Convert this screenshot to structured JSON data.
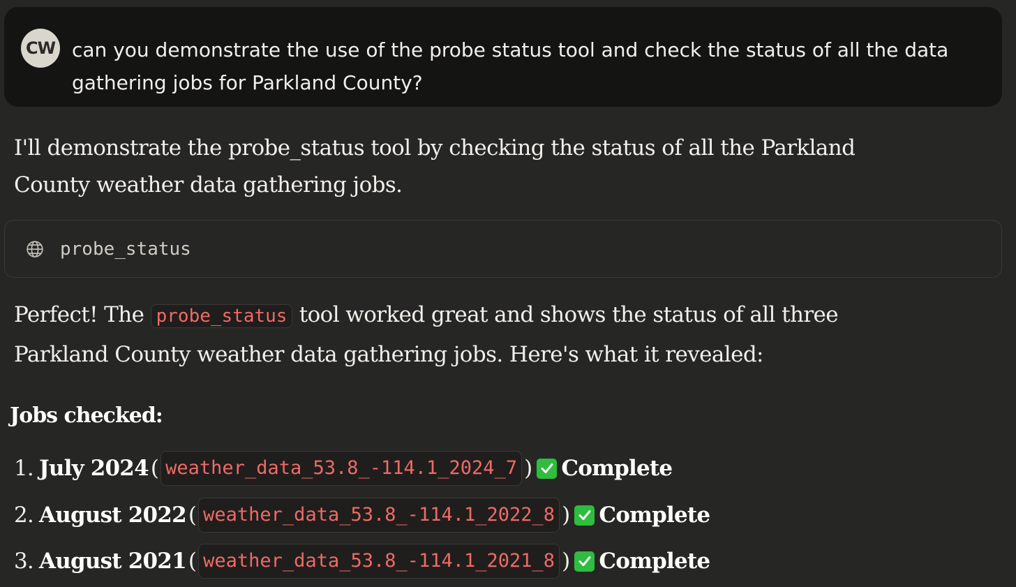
{
  "user_message": {
    "avatar_initials": "CW",
    "text": "can you demonstrate the use of the probe status tool and check the status of all the data gathering jobs for Parkland County?"
  },
  "assistant": {
    "intro": "I'll demonstrate the probe_status tool by checking the status of all the Parkland County weather data gathering jobs.",
    "tool_call": {
      "icon": "globe-icon",
      "name": "probe_status"
    },
    "result": {
      "before": "Perfect! The ",
      "code": "probe_status",
      "after": " tool worked great and shows the status of all three Parkland County weather data gathering jobs. Here's what it revealed:"
    },
    "jobs_heading": "Jobs checked:",
    "jobs": [
      {
        "number": "1.",
        "label": "July 2024",
        "job_id": "weather_data_53.8_-114.1_2024_7",
        "status": "Complete"
      },
      {
        "number": "2.",
        "label": "August 2022",
        "job_id": "weather_data_53.8_-114.1_2022_8",
        "status": "Complete"
      },
      {
        "number": "3.",
        "label": "August 2021",
        "job_id": "weather_data_53.8_-114.1_2021_8",
        "status": "Complete"
      }
    ]
  },
  "colors": {
    "background": "#262624",
    "user_bubble": "#141413",
    "inline_code": "#ef6a66",
    "check": "#2ebd3e"
  }
}
